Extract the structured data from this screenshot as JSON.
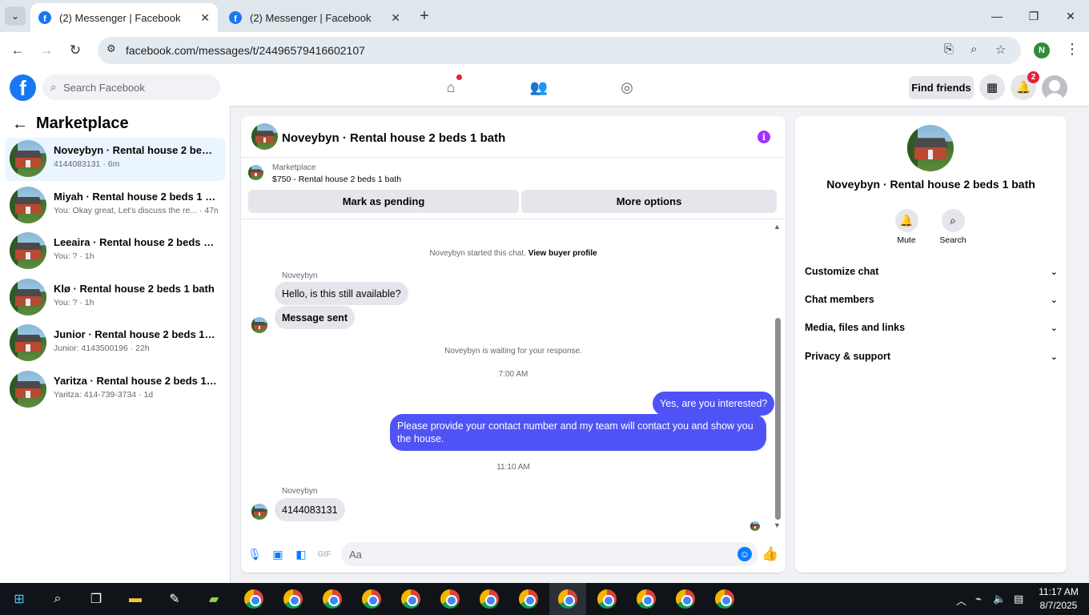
{
  "browser": {
    "tabs": [
      {
        "title": "(2) Messenger | Facebook",
        "active": true
      },
      {
        "title": "(2) Messenger | Facebook",
        "active": false
      }
    ],
    "url": "facebook.com/messages/t/24496579416602107",
    "profile_initial": "N"
  },
  "fb_header": {
    "search_placeholder": "Search Facebook",
    "find_friends": "Find friends",
    "notification_count": "2",
    "brand_color": "#1877f2"
  },
  "left": {
    "title": "Marketplace",
    "conversations": [
      {
        "name": "Noveybyn · Rental house 2 beds 1 ...",
        "sub": "4144083131 · 6m",
        "selected": true
      },
      {
        "name": "Miyah · Rental house 2 beds 1 bath",
        "sub": "You: Okay great, Let's discuss the re... · 47m"
      },
      {
        "name": "Leeaira · Rental house 2 beds 1 bath",
        "sub": "You: ? · 1h"
      },
      {
        "name": "Klø · Rental house 2 beds 1 bath",
        "sub": "You: ? · 1h"
      },
      {
        "name": "Junior · Rental house 2 beds 1 bath",
        "sub": "Junior: 4143500196 · 22h"
      },
      {
        "name": "Yaritza · Rental house 2 beds 1 bath",
        "sub": "Yaritza: 414-739-3734 · 1d"
      }
    ]
  },
  "chat": {
    "title": "Noveybyn · Rental house 2 beds 1 bath",
    "marketplace_label": "Marketplace",
    "listing": "$750 - Rental house 2 beds 1 bath",
    "mark_pending": "Mark as pending",
    "more_options": "More options",
    "started_text": "Noveybyn started this chat.",
    "view_profile": "View buyer profile",
    "sender_name": "Noveybyn",
    "msg_in_1": "Hello, is this still available?",
    "msg_in_2": "Message sent",
    "waiting_text": "Noveybyn is waiting for your response.",
    "time_1": "7:00 AM",
    "msg_out_1": "Yes, are you interested?",
    "msg_out_2": "Please provide your contact number and my team will contact you and show you the house.",
    "time_2": "11:10 AM",
    "msg_in_3": "4144083131",
    "composer_placeholder": "Aa",
    "outgoing_color": "#4f53f6"
  },
  "right": {
    "title": "Noveybyn · Rental house 2 beds 1 bath",
    "mute_label": "Mute",
    "search_label": "Search",
    "sections": [
      "Customize chat",
      "Chat members",
      "Media, files and links",
      "Privacy & support"
    ]
  },
  "taskbar": {
    "time": "11:17 AM",
    "date": "8/7/2025"
  }
}
